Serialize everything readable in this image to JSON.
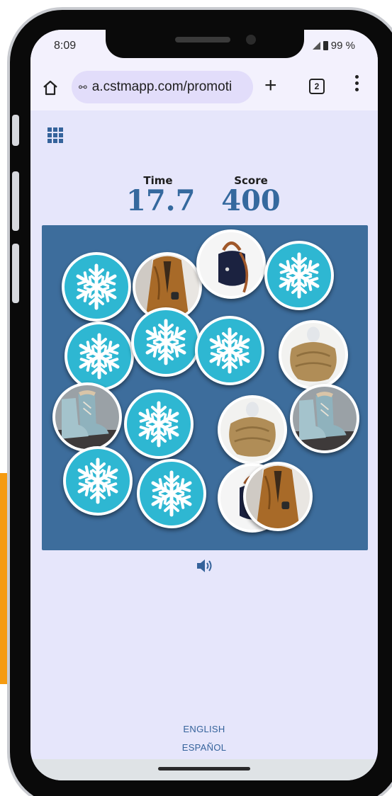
{
  "status_bar": {
    "time": "8:09",
    "battery": "99 %"
  },
  "browser": {
    "url": "a.cstmapp.com/promoti",
    "tab_count": "2",
    "home_icon": "home-icon",
    "new_tab_icon": "plus-icon",
    "menu_icon": "kebab-menu-icon"
  },
  "game": {
    "menu_icon": "grid-menu-icon",
    "time_label": "Time",
    "time_value": "17.7",
    "score_label": "Score",
    "score_value": "400",
    "sound_icon": "speaker-icon",
    "board_color": "#3d6d9c",
    "card_back_color": "#2eb7d2",
    "cards": [
      {
        "face": "snowflake"
      },
      {
        "face": "coat"
      },
      {
        "face": "bag"
      },
      {
        "face": "snowflake"
      },
      {
        "face": "snowflake"
      },
      {
        "face": "snowflake"
      },
      {
        "face": "snowflake"
      },
      {
        "face": "scarf"
      },
      {
        "face": "boots"
      },
      {
        "face": "snowflake"
      },
      {
        "face": "scarf"
      },
      {
        "face": "boots"
      },
      {
        "face": "snowflake"
      },
      {
        "face": "snowflake"
      },
      {
        "face": "bag"
      },
      {
        "face": "coat"
      }
    ]
  },
  "footer": {
    "english": "ENGLISH",
    "spanish": "ESPAÑOL"
  }
}
